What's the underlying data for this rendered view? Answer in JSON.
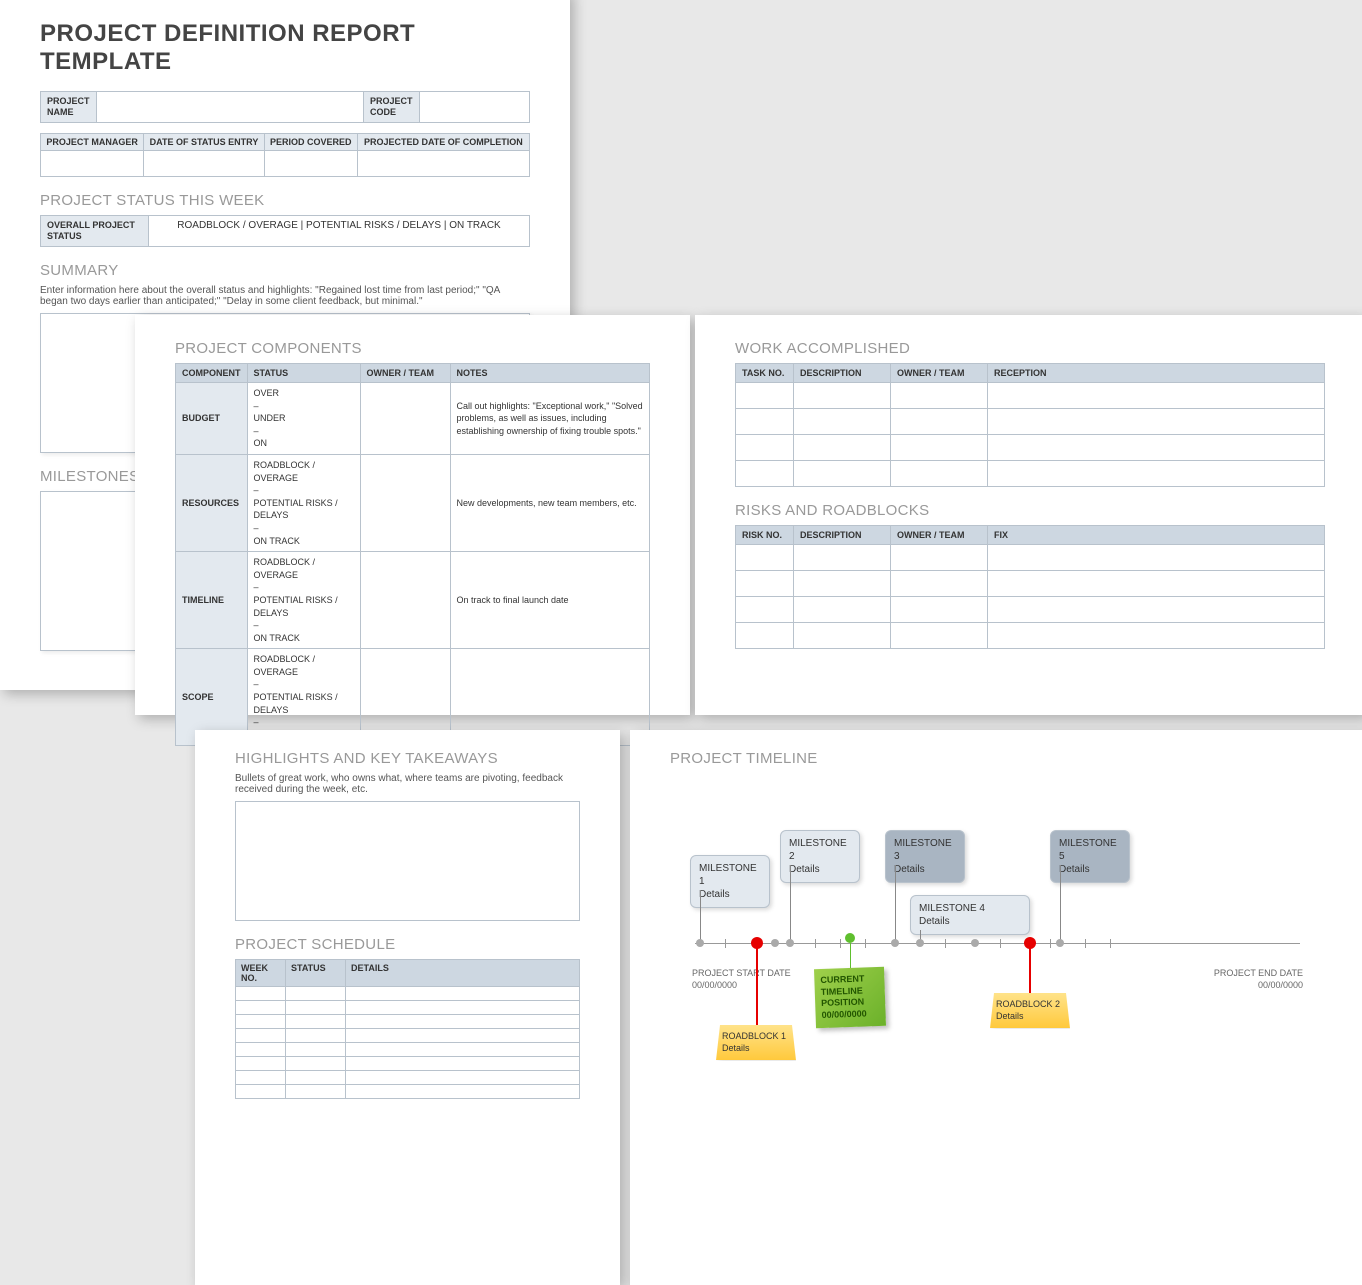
{
  "page1": {
    "title": "PROJECT DEFINITION REPORT TEMPLATE",
    "project_name_label": "PROJECT NAME",
    "project_code_label": "PROJECT CODE",
    "meta_headers": [
      "PROJECT MANAGER",
      "DATE OF STATUS ENTRY",
      "PERIOD COVERED",
      "PROJECTED DATE OF COMPLETION"
    ],
    "status_section": "PROJECT STATUS THIS WEEK",
    "overall_label": "OVERALL PROJECT STATUS",
    "status_options": "ROADBLOCK / OVERAGE    |    POTENTIAL RISKS / DELAYS    |    ON TRACK",
    "summary_heading": "SUMMARY",
    "summary_text": "Enter information here about the overall status and highlights: \"Regained lost time from last period;\" \"QA began two days earlier than anticipated;\" \"Delay in some client feedback, but minimal.\"",
    "milestones_heading": "MILESTONES"
  },
  "page2": {
    "heading": "PROJECT COMPONENTS",
    "headers": [
      "COMPONENT",
      "STATUS",
      "OWNER / TEAM",
      "NOTES"
    ],
    "rows": [
      {
        "name": "BUDGET",
        "status": "OVER\n–\nUNDER\n–\nON",
        "notes": "Call out highlights: \"Exceptional work,\" \"Solved problems, as well as issues, including establishing ownership of fixing trouble spots.\""
      },
      {
        "name": "RESOURCES",
        "status": "ROADBLOCK / OVERAGE\n–\nPOTENTIAL RISKS / DELAYS\n–\nON TRACK",
        "notes": "New developments, new team members, etc."
      },
      {
        "name": "TIMELINE",
        "status": "ROADBLOCK / OVERAGE\n–\nPOTENTIAL RISKS / DELAYS\n–\nON TRACK",
        "notes": "On track to final launch date"
      },
      {
        "name": "SCOPE",
        "status": "ROADBLOCK / OVERAGE\n–\nPOTENTIAL RISKS / DELAYS\n–\nON TRACK",
        "notes": ""
      }
    ]
  },
  "page3": {
    "work_heading": "WORK ACCOMPLISHED",
    "work_headers": [
      "TASK NO.",
      "DESCRIPTION",
      "OWNER / TEAM",
      "RECEPTION"
    ],
    "risks_heading": "RISKS AND ROADBLOCKS",
    "risks_headers": [
      "RISK NO.",
      "DESCRIPTION",
      "OWNER / TEAM",
      "FIX"
    ]
  },
  "page4": {
    "highlights_heading": "HIGHLIGHTS AND KEY TAKEAWAYS",
    "highlights_text": "Bullets of great work, who owns what, where teams are pivoting, feedback received during the week, etc.",
    "schedule_heading": "PROJECT SCHEDULE",
    "schedule_headers": [
      "WEEK NO.",
      "STATUS",
      "DETAILS"
    ]
  },
  "page5": {
    "heading": "PROJECT TIMELINE",
    "milestones": [
      {
        "title": "MILESTONE 1",
        "detail": "Details"
      },
      {
        "title": "MILESTONE 2",
        "detail": "Details"
      },
      {
        "title": "MILESTONE 3",
        "detail": "Details"
      },
      {
        "title": "MILESTONE 4",
        "detail": "Details"
      },
      {
        "title": "MILESTONE 5",
        "detail": "Details"
      }
    ],
    "start_label": "PROJECT START DATE",
    "start_date": "00/00/0000",
    "end_label": "PROJECT END DATE",
    "end_date": "00/00/0000",
    "current_label": "CURRENT TIMELINE POSITION",
    "current_date": "00/00/0000",
    "roadblocks": [
      {
        "title": "ROADBLOCK 1",
        "detail": "Details"
      },
      {
        "title": "ROADBLOCK 2",
        "detail": "Details"
      }
    ]
  }
}
